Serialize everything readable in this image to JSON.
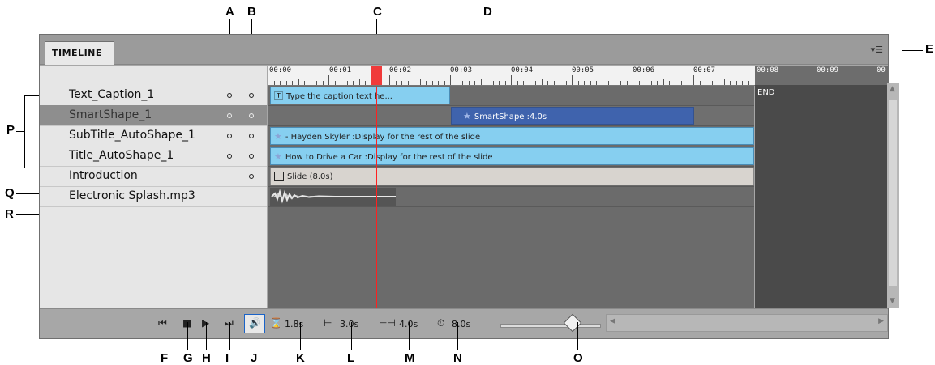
{
  "callouts": {
    "A": "A",
    "B": "B",
    "C": "C",
    "D": "D",
    "E": "E",
    "F": "F",
    "G": "G",
    "H": "H",
    "I": "I",
    "J": "J",
    "K": "K",
    "L": "L",
    "M": "M",
    "N": "N",
    "O": "O",
    "P": "P",
    "Q": "Q",
    "R": "R"
  },
  "panel": {
    "tab_label": "TIMELINE",
    "menu_glyph": "▾☰"
  },
  "layers": [
    {
      "name": "Text_Caption_1",
      "selected": false,
      "eye": true,
      "lock": true
    },
    {
      "name": "SmartShape_1",
      "selected": true,
      "eye": true,
      "lock": true
    },
    {
      "name": "SubTitle_AutoShape_1",
      "selected": false,
      "eye": true,
      "lock": true
    },
    {
      "name": "Title_AutoShape_1",
      "selected": false,
      "eye": true,
      "lock": true
    },
    {
      "name": "Introduction",
      "selected": false,
      "eye": false,
      "lock": true
    },
    {
      "name": "Electronic Splash.mp3",
      "selected": false,
      "eye": false,
      "lock": false
    }
  ],
  "ruler": {
    "ticks": [
      "00:00",
      "00:01",
      "00:02",
      "00:03",
      "00:04",
      "00:05",
      "00:06",
      "00:07"
    ],
    "end_ticks": [
      "00:08",
      "00:09",
      "00"
    ]
  },
  "clips": {
    "caption": "Type the caption text he...",
    "smartshape": "SmartShape :4.0s",
    "subtitle": "- Hayden Skyler :Display for the rest of the slide",
    "title": "How to Drive a Car :Display for the rest of the slide",
    "slide": "Slide (8.0s)"
  },
  "end_label": "END",
  "controls": {
    "current_time": "1.8s",
    "start_time": "3.0s",
    "duration": "4.0s",
    "slide_duration": "8.0s",
    "zoom_level": 0.72
  },
  "colors": {
    "clip_blue": "#86cff0",
    "clip_dark": "#3f63ad",
    "playhead": "#ff2020",
    "end_zone": "#4a4a4a"
  }
}
